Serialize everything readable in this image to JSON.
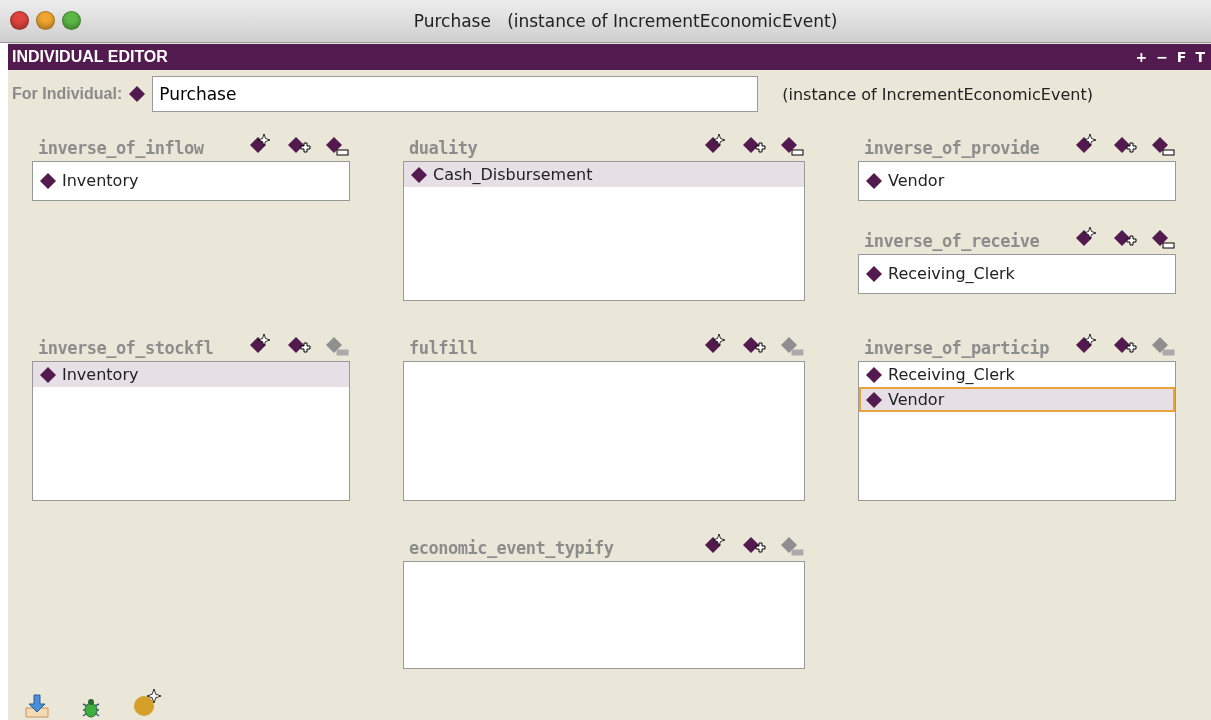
{
  "window": {
    "title": "Purchase   (instance of IncrementEconomicEvent)"
  },
  "editor": {
    "title": "INDIVIDUAL EDITOR",
    "header_buttons": [
      "+",
      "−",
      "F",
      "T"
    ]
  },
  "individual": {
    "label": "For Individual:",
    "value": "Purchase",
    "type_note": "(instance of IncrementEconomicEvent)"
  },
  "columns": [
    {
      "groups": [
        {
          "slots": [
            {
              "label": "inverse_of_inflow",
              "kind": "single",
              "remove_disabled": false,
              "values": [
                {
                  "name": "Inventory",
                  "selected": false,
                  "focused": false
                }
              ]
            }
          ]
        },
        {
          "slots": [
            {
              "label": "inverse_of_stockfl",
              "kind": "multi",
              "remove_disabled": true,
              "values": [
                {
                  "name": "Inventory",
                  "selected": true,
                  "focused": false
                }
              ]
            }
          ]
        }
      ]
    },
    {
      "groups": [
        {
          "slots": [
            {
              "label": "duality",
              "kind": "multi",
              "remove_disabled": false,
              "values": [
                {
                  "name": "Cash_Disbursement",
                  "selected": true,
                  "focused": false
                }
              ]
            }
          ]
        },
        {
          "slots": [
            {
              "label": "fulfill",
              "kind": "multi",
              "remove_disabled": true
            }
          ]
        },
        {
          "slots": [
            {
              "label": "economic_event_typify",
              "kind": "short",
              "remove_disabled": true
            }
          ]
        }
      ]
    },
    {
      "groups": [
        {
          "slots": [
            {
              "label": "inverse_of_provide",
              "kind": "single",
              "remove_disabled": false,
              "values": [
                {
                  "name": "Vendor",
                  "selected": false,
                  "focused": false
                }
              ]
            },
            {
              "label": "inverse_of_receive",
              "kind": "single",
              "remove_disabled": false,
              "values": [
                {
                  "name": "Receiving_Clerk",
                  "selected": false,
                  "focused": false
                }
              ]
            }
          ]
        },
        {
          "slots": [
            {
              "label": "inverse_of_particip",
              "kind": "multi",
              "remove_disabled": true,
              "values": [
                {
                  "name": "Receiving_Clerk",
                  "selected": false,
                  "focused": false
                },
                {
                  "name": "Vendor",
                  "selected": true,
                  "focused": true
                }
              ]
            }
          ]
        }
      ]
    }
  ]
}
